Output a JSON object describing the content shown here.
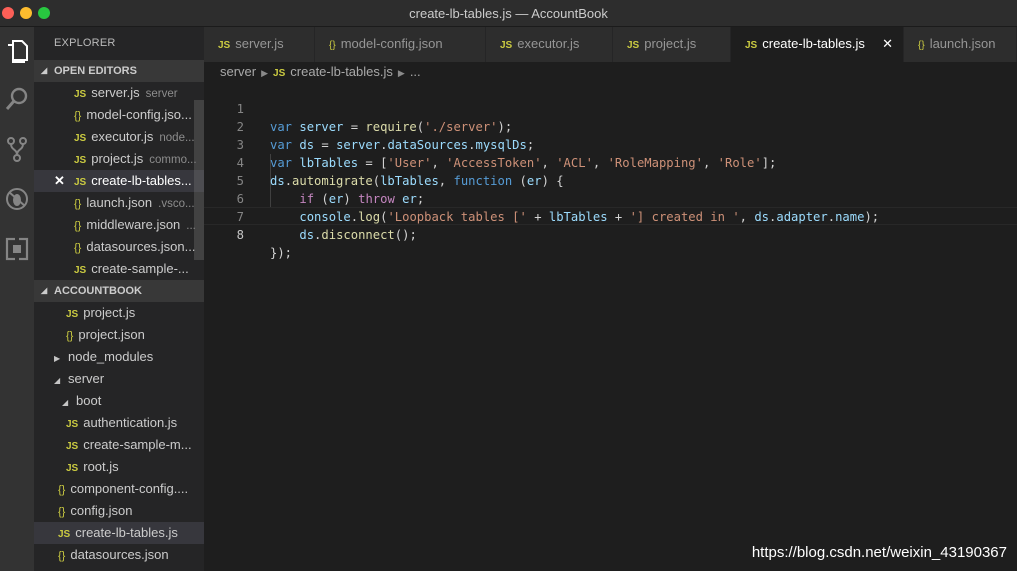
{
  "window": {
    "title": "create-lb-tables.js — AccountBook"
  },
  "activity_bar": [
    {
      "name": "files-icon"
    },
    {
      "name": "search-icon"
    },
    {
      "name": "source-control-icon"
    },
    {
      "name": "debug-icon"
    },
    {
      "name": "extensions-icon"
    }
  ],
  "sidebar": {
    "title": "EXPLORER",
    "open_editors_header": "OPEN EDITORS",
    "project_header": "ACCOUNTBOOK",
    "open_editors": [
      {
        "icon": "JS",
        "label": "server.js",
        "desc": "server"
      },
      {
        "icon": "{}",
        "label": "model-config.jso...",
        "desc": ""
      },
      {
        "icon": "JS",
        "label": "executor.js",
        "desc": "node..."
      },
      {
        "icon": "JS",
        "label": "project.js",
        "desc": "commo..."
      },
      {
        "icon": "JS",
        "label": "create-lb-tables...",
        "desc": ""
      },
      {
        "icon": "{}",
        "label": "launch.json",
        "desc": ".vsco..."
      },
      {
        "icon": "{}",
        "label": "middleware.json",
        "desc": "..."
      },
      {
        "icon": "{}",
        "label": "datasources.json...",
        "desc": ""
      },
      {
        "icon": "JS",
        "label": "create-sample-...",
        "desc": ""
      }
    ],
    "tree": [
      {
        "icon": "JS",
        "label": "project.js"
      },
      {
        "icon": "{}",
        "label": "project.json"
      },
      {
        "icon": "",
        "label": "node_modules"
      },
      {
        "icon": "",
        "label": "server"
      },
      {
        "icon": "",
        "label": "boot"
      },
      {
        "icon": "JS",
        "label": "authentication.js"
      },
      {
        "icon": "JS",
        "label": "create-sample-m..."
      },
      {
        "icon": "JS",
        "label": "root.js"
      },
      {
        "icon": "{}",
        "label": "component-config...."
      },
      {
        "icon": "{}",
        "label": "config.json"
      },
      {
        "icon": "JS",
        "label": "create-lb-tables.js"
      },
      {
        "icon": "{}",
        "label": "datasources.json"
      }
    ],
    "twisty_collapsed": "▶",
    "twisty_expanded": "◢",
    "close_glyph": "✕"
  },
  "tabs": [
    {
      "icon": "JS",
      "label": "server.js"
    },
    {
      "icon": "{}",
      "label": "model-config.json"
    },
    {
      "icon": "JS",
      "label": "executor.js"
    },
    {
      "icon": "JS",
      "label": "project.js"
    },
    {
      "icon": "JS",
      "label": "create-lb-tables.js",
      "active": true
    },
    {
      "icon": "{}",
      "label": "launch.json"
    }
  ],
  "tab_close": "✕",
  "breadcrumb": {
    "folder": "server",
    "icon": "JS",
    "file": "create-lb-tables.js",
    "more": "...",
    "sep": "▶"
  },
  "editor": {
    "current_line": 8,
    "line_numbers": [
      "1",
      "2",
      "3",
      "4",
      "5",
      "6",
      "7",
      "8"
    ],
    "code": {
      "l1": [
        "var",
        " ",
        "server",
        " = ",
        "require",
        "(",
        "'./server'",
        ");"
      ],
      "l2": [
        "var",
        " ",
        "ds",
        " = ",
        "server",
        ".",
        "dataSources",
        ".",
        "mysqlDs",
        ";"
      ],
      "l3": [
        "var",
        " ",
        "lbTables",
        " = [",
        "'User'",
        ", ",
        "'AccessToken'",
        ", ",
        "'ACL'",
        ", ",
        "'RoleMapping'",
        ", ",
        "'Role'",
        "];"
      ],
      "l4": [
        "ds",
        ".",
        "automigrate",
        "(",
        "lbTables",
        ", ",
        "function",
        " (",
        "er",
        ") {"
      ],
      "l5": [
        "    ",
        "if",
        " (",
        "er",
        ") ",
        "throw",
        " ",
        "er",
        ";"
      ],
      "l6": [
        "    ",
        "console",
        ".",
        "log",
        "(",
        "'Loopback tables ['",
        " + ",
        "lbTables",
        " + ",
        "'] created in '",
        ", ",
        "ds",
        ".",
        "adapter",
        ".",
        "name",
        ");"
      ],
      "l7": [
        "    ",
        "ds",
        ".",
        "disconnect",
        "();"
      ],
      "l8": [
        "});"
      ]
    }
  },
  "watermark": "https://blog.csdn.net/weixin_43190367"
}
